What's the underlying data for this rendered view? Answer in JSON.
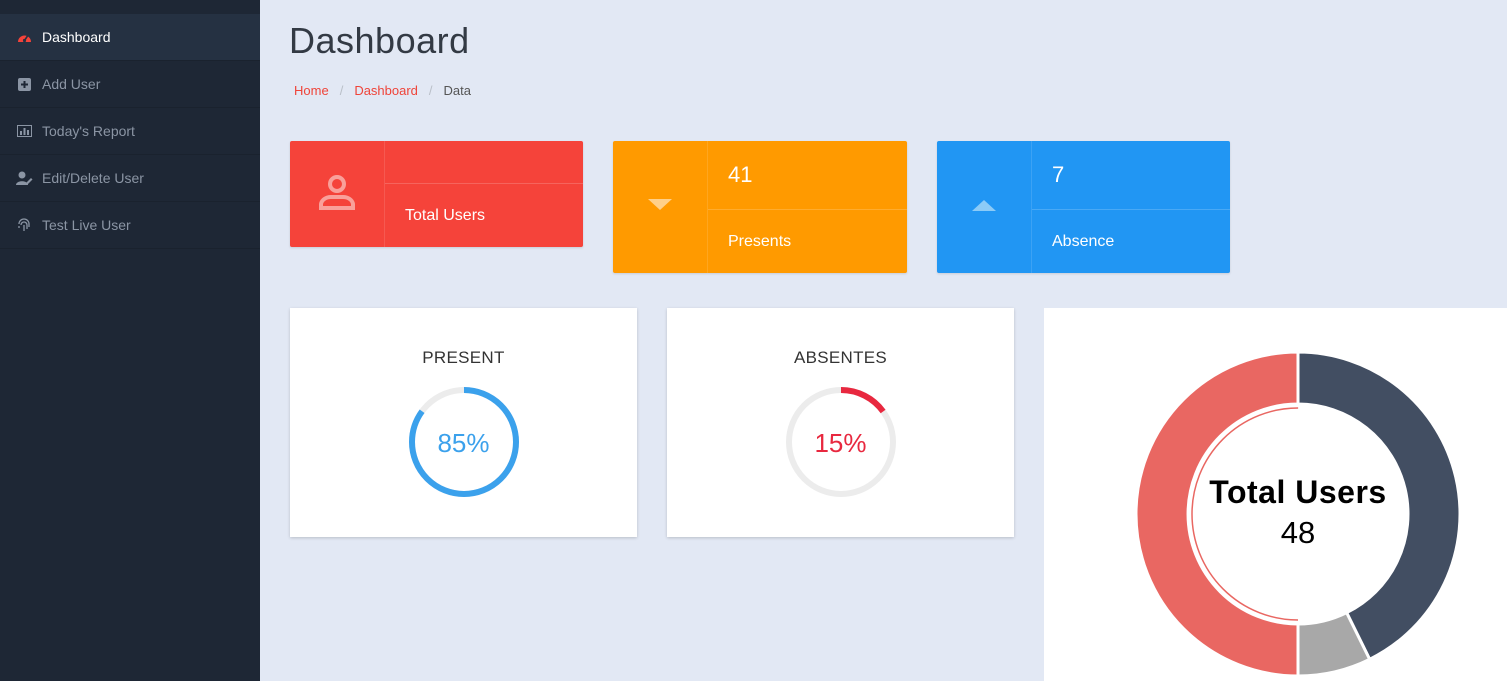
{
  "sidebar": {
    "items": [
      {
        "label": "Dashboard",
        "icon": "dashboard-icon",
        "active": true
      },
      {
        "label": "Add User",
        "icon": "plus-square-icon"
      },
      {
        "label": "Today's Report",
        "icon": "bar-chart-icon"
      },
      {
        "label": "Edit/Delete User",
        "icon": "user-edit-icon"
      },
      {
        "label": "Test Live User",
        "icon": "fingerprint-icon"
      }
    ]
  },
  "header": {
    "title": "Dashboard",
    "breadcrumb": [
      "Home",
      "Dashboard",
      "Data"
    ]
  },
  "stats": {
    "total": {
      "value": "",
      "label": "Total Users",
      "color": "#f5433a",
      "icon": "user-icon"
    },
    "presents": {
      "value": "41",
      "label": "Presents",
      "color": "#ff9a00",
      "icon": "caret-down-icon"
    },
    "absence": {
      "value": "7",
      "label": "Absence",
      "color": "#2196f3",
      "icon": "caret-up-icon"
    }
  },
  "progress": {
    "present": {
      "title": "PRESENT",
      "percent_text": "85%",
      "percent": 85,
      "color": "#3ba1ec"
    },
    "absentes": {
      "title": "ABSENTES",
      "percent_text": "15%",
      "percent": 15,
      "color": "#e8283f"
    }
  },
  "donut": {
    "title": "Total Users",
    "value": "48",
    "segments": [
      {
        "value": 41,
        "color": "#424e62"
      },
      {
        "value": 7,
        "color": "#a8a8a8"
      },
      {
        "value": 48,
        "color": "#e96762"
      }
    ]
  }
}
